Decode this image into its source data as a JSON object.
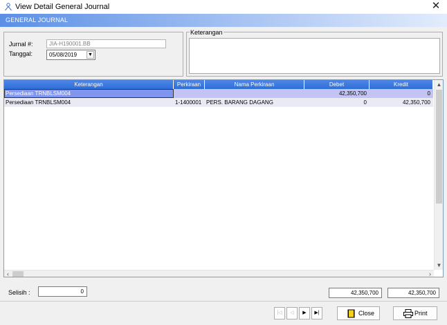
{
  "window": {
    "title": "View Detail General Journal",
    "close_glyph": "✕"
  },
  "header": {
    "label": "GENERAL JOURNAL"
  },
  "form": {
    "jurnal_label": "Jurnal #:",
    "jurnal_value": "JIA-H190001.BB",
    "tanggal_label": "Tanggal:",
    "tanggal_value": "05/08/2019",
    "keterangan_label": "Keterangan",
    "keterangan_value": ""
  },
  "grid": {
    "columns": [
      "Keterangan",
      "Perkiraan",
      "Nama Perkiraan",
      "Debet",
      "Kredit"
    ],
    "rows": [
      {
        "keterangan": "Persediaan TRNBLSM004",
        "perkiraan": "",
        "nama": "",
        "debet": "42,350,700",
        "kredit": "0"
      },
      {
        "keterangan": "Persediaan TRNBLSM004",
        "perkiraan": "1-1400001",
        "nama": "PERS. BARANG DAGANG",
        "debet": "0",
        "kredit": "42,350,700"
      }
    ]
  },
  "summary": {
    "selisih_label": "Selisih  :",
    "selisih_value": "0",
    "total_debet": "42,350,700",
    "total_kredit": "42,350,700"
  },
  "nav": {
    "first": "|◁",
    "prev": "◁",
    "next": "▶",
    "last": "▶|"
  },
  "buttons": {
    "close": "Close",
    "print": "Print"
  },
  "colors": {
    "header_start": "#5b8fe5",
    "grid_header": "#2e6ed8",
    "selected_row": "#c4c4f4"
  }
}
